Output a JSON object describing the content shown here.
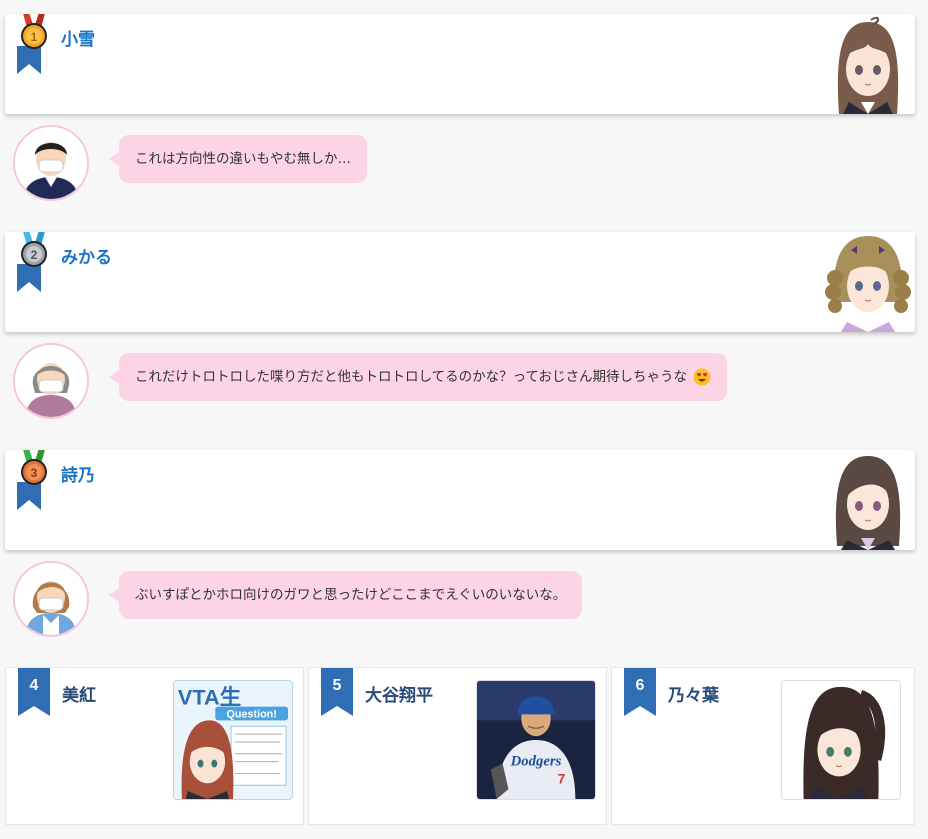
{
  "ranking": [
    {
      "rank": 1,
      "medal_icon": "gold-medal-icon",
      "name": "小雪",
      "avatar_icon": "character-avatar-brown-hair"
    },
    {
      "rank": 2,
      "medal_icon": "silver-medal-icon",
      "name": "みかる",
      "avatar_icon": "character-avatar-blonde-braids"
    },
    {
      "rank": 3,
      "medal_icon": "bronze-medal-icon",
      "name": "詩乃",
      "avatar_icon": "character-avatar-dark-hair"
    }
  ],
  "comments": [
    {
      "user_icon": "masked-man-avatar-icon",
      "text": "これは方向性の違いもやむ無しか…"
    },
    {
      "user_icon": "masked-elderly-woman-avatar-icon",
      "text": "これだけトロトロした喋り方だと他もトロトロしてるのかな？っておじさん期待しちゃうな",
      "emoji": "heart-eyes-emoji"
    },
    {
      "user_icon": "masked-woman-avatar-icon",
      "text": "ぶいすぽとかホロ向けのガワと思ったけどここまでえぐいのいないな。"
    }
  ],
  "runners_up": [
    {
      "rank": "4",
      "name": "美紅",
      "thumb_title": "VTA生",
      "thumb_subtitle": "Question!"
    },
    {
      "rank": "5",
      "name": "大谷翔平",
      "thumb_jersey": "Dodgers"
    },
    {
      "rank": "6",
      "name": "乃々葉"
    }
  ],
  "colors": {
    "name_blue": "#1a73c7",
    "bubble_pink": "#fcd4e6",
    "ribbon_blue": "#2f6db5",
    "gold": "#f5a623",
    "silver": "#9aa3ad",
    "bronze": "#e0743a"
  }
}
